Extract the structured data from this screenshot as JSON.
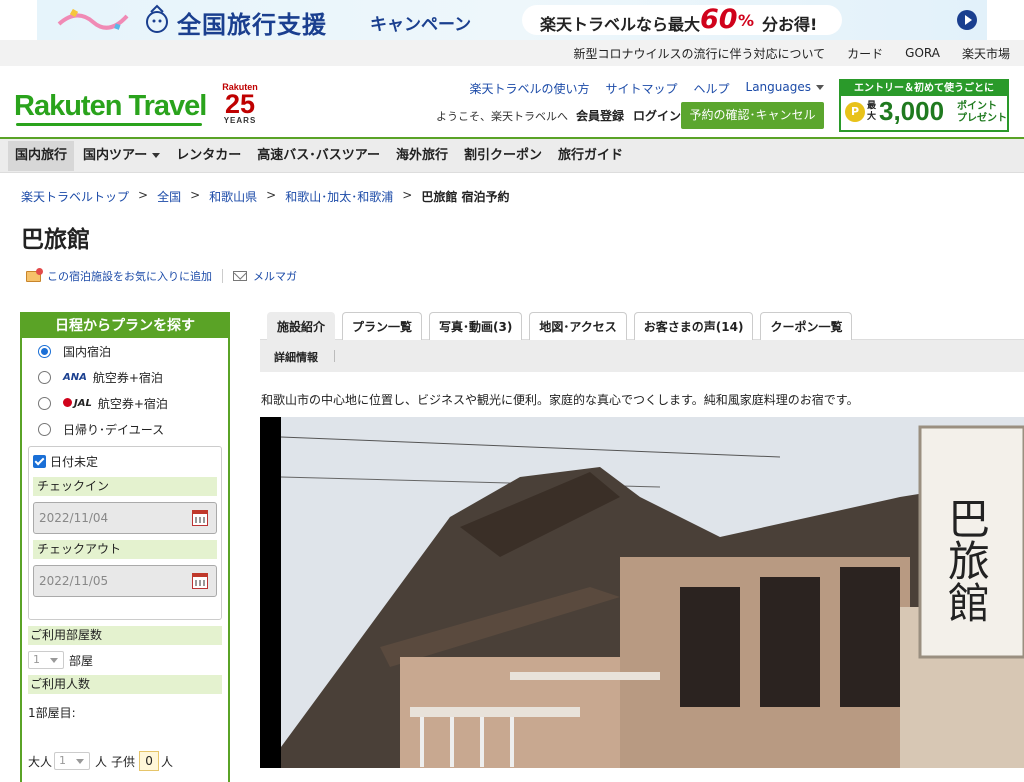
{
  "banner": {
    "title": "全国旅行支援",
    "subtitle": "キャンペーン",
    "pill_prefix": "楽天トラベルなら最大",
    "pill_percent": "60",
    "pill_percent_sign": "%",
    "pill_suffix": "分お得!"
  },
  "utility_links": [
    "新型コロナウイルスの流行に伴う対応について",
    "カード",
    "GORA",
    "楽天市場"
  ],
  "header": {
    "logo": "Rakuten Travel",
    "years_brand": "Rakuten",
    "years_number": "25",
    "years_label": "YEARS",
    "links": [
      "楽天トラベルの使い方",
      "サイトマップ",
      "ヘルプ",
      "Languages"
    ],
    "welcome": "ようこそ、楽天トラベルへ",
    "member": "会員登録",
    "login": "ログイン",
    "reserve_button": "予約の確認･キャンセル",
    "promo": {
      "top": "エントリー＆初めて使うごとに",
      "coin": "P",
      "max": "最大",
      "amount": "3,000",
      "points_line1": "ポイント",
      "points_line2": "プレゼント"
    }
  },
  "nav": [
    {
      "label": "国内旅行",
      "active": true,
      "dropdown": false
    },
    {
      "label": "国内ツアー",
      "active": false,
      "dropdown": true
    },
    {
      "label": "レンタカー",
      "active": false,
      "dropdown": false
    },
    {
      "label": "高速バス･バスツアー",
      "active": false,
      "dropdown": false
    },
    {
      "label": "海外旅行",
      "active": false,
      "dropdown": false
    },
    {
      "label": "割引クーポン",
      "active": false,
      "dropdown": false
    },
    {
      "label": "旅行ガイド",
      "active": false,
      "dropdown": false
    }
  ],
  "breadcrumb": [
    "楽天トラベルトップ",
    "全国",
    "和歌山県",
    "和歌山･加太･和歌浦"
  ],
  "breadcrumb_sep": ">",
  "breadcrumb_current": "巴旅館 宿泊予約",
  "hotel_name": "巴旅館",
  "actions": {
    "favorite": "この宿泊施設をお気に入りに追加",
    "mailmag": "メルマガ"
  },
  "sidebar": {
    "header": "日程からプランを探す",
    "options": [
      {
        "label": "国内宿泊",
        "selected": true,
        "airline": ""
      },
      {
        "label": "航空券+宿泊",
        "selected": false,
        "airline": "ANA"
      },
      {
        "label": "航空券+宿泊",
        "selected": false,
        "airline": "JAL"
      },
      {
        "label": "日帰り･デイユース",
        "selected": false,
        "airline": ""
      }
    ],
    "date_undecided": "日付未定",
    "checkin_label": "チェックイン",
    "checkin_value": "2022/11/04",
    "checkout_label": "チェックアウト",
    "checkout_value": "2022/11/05",
    "rooms_label": "ご利用部屋数",
    "rooms_value": "1",
    "rooms_unit": "部屋",
    "guests_label": "ご利用人数",
    "room1_label": "1部屋目:",
    "adults_label": "大人",
    "adults_value": "1",
    "adults_unit": "人",
    "children_label": "子供",
    "children_value": "0",
    "children_unit": "人"
  },
  "tabs": [
    {
      "label": "施設紹介",
      "active": true
    },
    {
      "label": "プラン一覧",
      "active": false
    },
    {
      "label": "写真･動画(3)",
      "active": false
    },
    {
      "label": "地図･アクセス",
      "active": false
    },
    {
      "label": "お客さまの声(14)",
      "active": false
    },
    {
      "label": "クーポン一覧",
      "active": false
    }
  ],
  "subtab": "詳細情報",
  "description": "和歌山市の中心地に位置し、ビジネスや観光に便利。家庭的な真心でつくします。純和風家庭料理のお宿です。",
  "photo_sign": "巴旅館"
}
